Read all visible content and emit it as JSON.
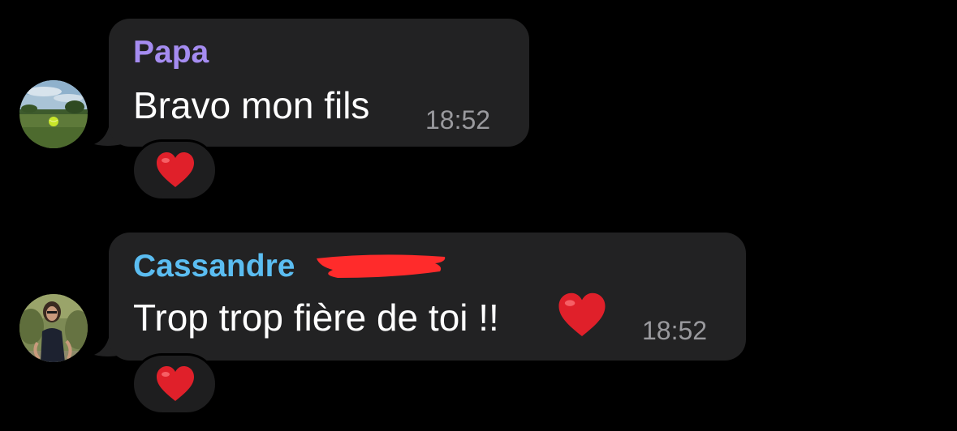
{
  "messages": [
    {
      "sender": "Papa",
      "sender_color": "#a58cf0",
      "text": "Bravo mon fils",
      "time": "18:52",
      "reaction": "red-heart",
      "avatar": "landscape-photo-avatar"
    },
    {
      "sender": "Cassandre",
      "sender_color": "#5bbdf1",
      "text": "Trop trop fière de toi !!",
      "inline_emoji": "red-heart",
      "time": "18:52",
      "reaction": "red-heart",
      "avatar": "portrait-photo-avatar",
      "surname_redacted": true
    }
  ],
  "colors": {
    "background": "#000000",
    "bubble": "#222223",
    "time": "#9a9a9e",
    "heart": "#e0202a",
    "redaction": "#ff2b2b"
  }
}
